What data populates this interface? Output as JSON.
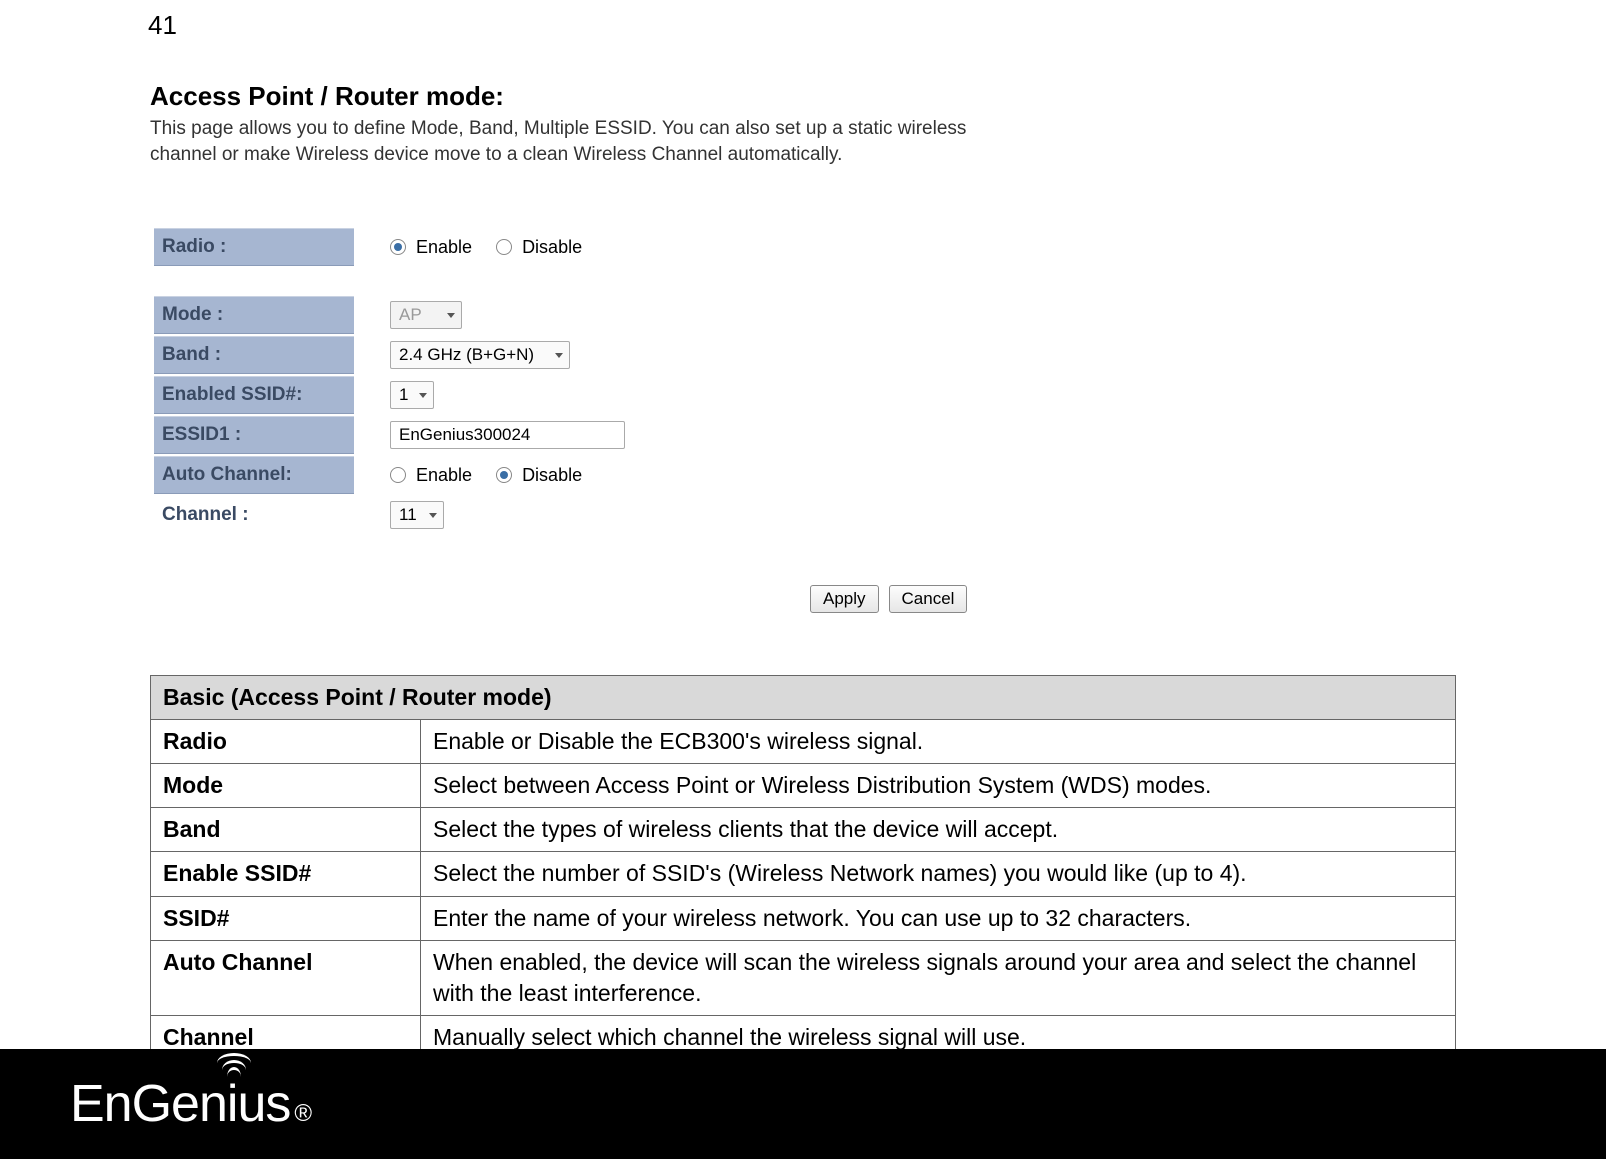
{
  "page_number": "41",
  "section_title": "Access Point / Router mode:",
  "intro_text": "This page allows you to define Mode, Band, Multiple ESSID. You can also set up a static wireless channel or make Wireless device move to a clean Wireless Channel automatically.",
  "form": {
    "radio": {
      "label": "Radio :",
      "enable": "Enable",
      "disable": "Disable",
      "checked": "enable"
    },
    "mode": {
      "label": "Mode :",
      "value": "AP"
    },
    "band": {
      "label": "Band :",
      "value": "2.4 GHz (B+G+N)"
    },
    "enabled_ssid": {
      "label": "Enabled SSID#:",
      "value": "1"
    },
    "essid1": {
      "label": "ESSID1 :",
      "value": "EnGenius300024"
    },
    "auto_channel": {
      "label": "Auto Channel:",
      "enable": "Enable",
      "disable": "Disable",
      "checked": "disable"
    },
    "channel": {
      "label": "Channel :",
      "value": "11"
    }
  },
  "buttons": {
    "apply": "Apply",
    "cancel": "Cancel"
  },
  "table": {
    "header": "Basic (Access Point / Router mode)",
    "rows": [
      {
        "label": "Radio",
        "desc": "Enable or Disable the ECB300's wireless signal."
      },
      {
        "label": "Mode",
        "desc": "Select between Access Point or Wireless Distribution System (WDS) modes."
      },
      {
        "label": "Band",
        "desc": "Select the types of wireless clients that the device will accept."
      },
      {
        "label": "Enable SSID#",
        "desc": "Select the number of SSID's (Wireless Network names) you would like (up to 4)."
      },
      {
        "label": "SSID#",
        "desc": "Enter the name of your wireless network. You can use up to 32 characters."
      },
      {
        "label": "Auto Channel",
        "desc": "When enabled, the device will scan the wireless signals around your area and select the channel with the least interference."
      },
      {
        "label": "Channel",
        "desc": "Manually select which channel the wireless signal will use."
      }
    ]
  },
  "brand": "EnGenius"
}
